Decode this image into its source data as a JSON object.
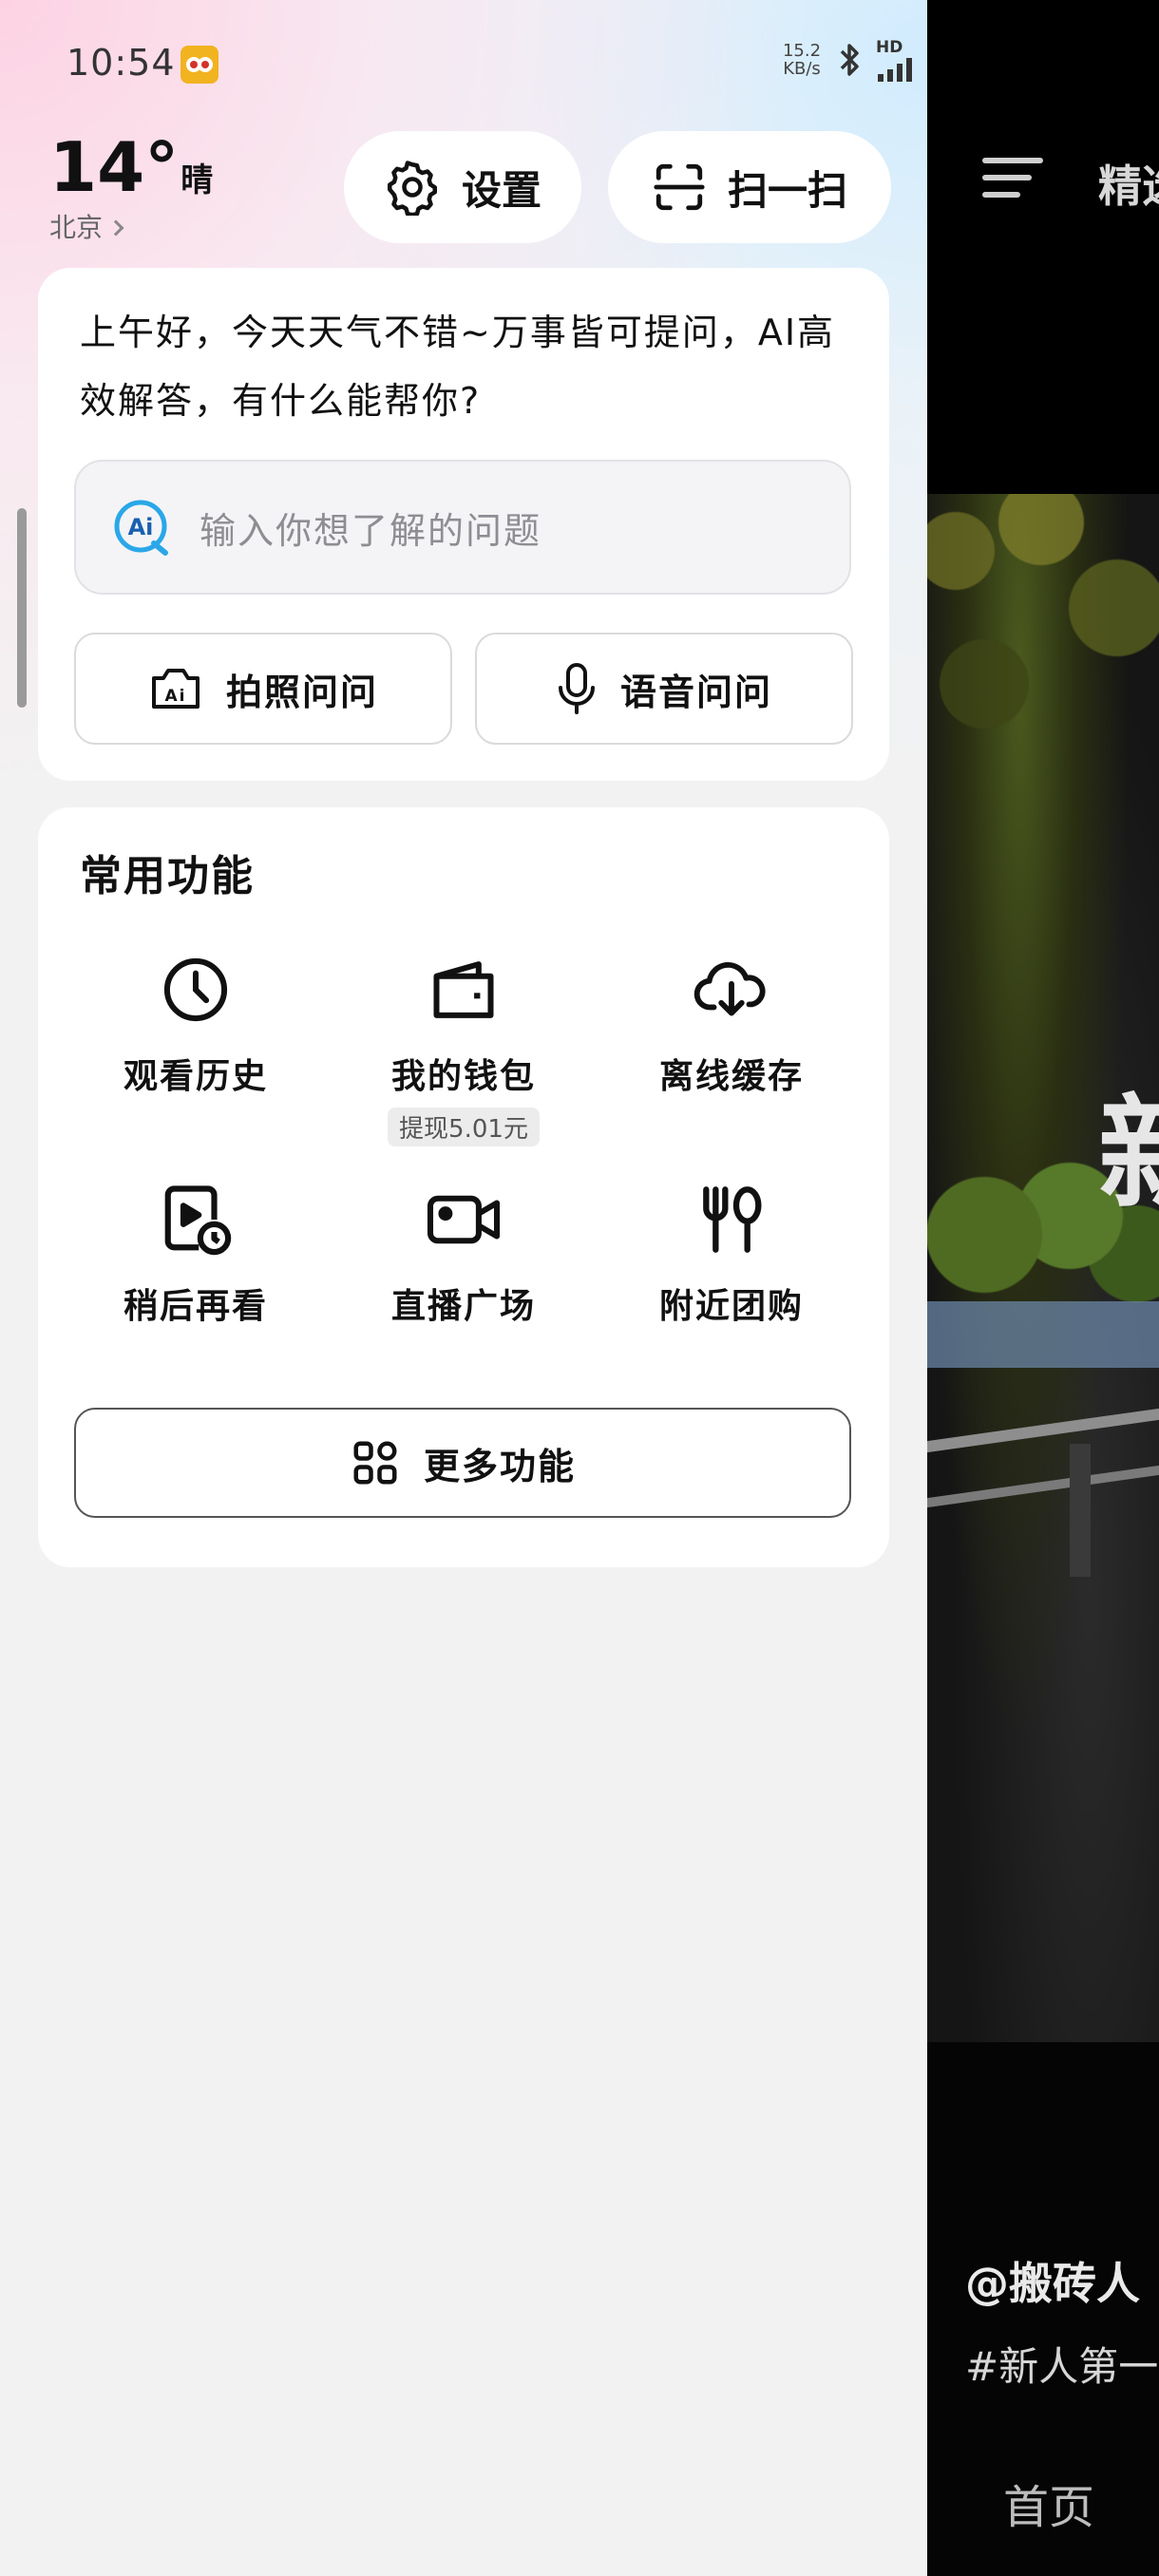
{
  "status_bar": {
    "time": "10:54",
    "net_speed": "15.2",
    "net_speed_unit": "KB/s",
    "hd_label": "HD"
  },
  "weather": {
    "temperature": "14°",
    "condition": "晴",
    "city": "北京"
  },
  "header_buttons": {
    "settings_label": "设置",
    "scan_label": "扫一扫"
  },
  "ai_card": {
    "greeting": "上午好，今天天气不错~万事皆可提问，AI高效解答，有什么能帮你?",
    "input_placeholder": "输入你想了解的问题",
    "photo_ask_label": "拍照问问",
    "voice_ask_label": "语音问问"
  },
  "functions": {
    "title": "常用功能",
    "items": [
      {
        "label": "观看历史",
        "icon": "clock-icon"
      },
      {
        "label": "我的钱包",
        "icon": "wallet-icon",
        "badge": "提现5.01元"
      },
      {
        "label": "离线缓存",
        "icon": "cloud-download-icon"
      },
      {
        "label": "稍后再看",
        "icon": "watch-later-icon"
      },
      {
        "label": "直播广场",
        "icon": "video-camera-icon"
      },
      {
        "label": "附近团购",
        "icon": "fork-spoon-icon"
      }
    ],
    "more_label": "更多功能"
  },
  "background_app": {
    "tab_label": "精选",
    "overlay_char": "新",
    "author": "@搬砖人",
    "hashtag": "#新人第一",
    "nav_home": "首页"
  },
  "colors": {
    "card_bg": "#ffffff",
    "page_bg": "#f2f2f2",
    "ai_icon_blue": "#2aa7e8"
  }
}
